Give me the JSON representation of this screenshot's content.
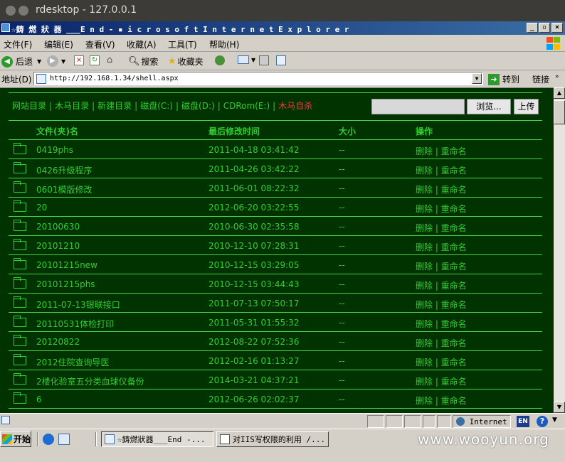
{
  "outer_window": {
    "title": "rdesktop - 127.0.0.1"
  },
  "ie_window": {
    "title": "☆鍒嗙狀鍣ㄦ___End - Microsoft Internet Explorer",
    "title_display": "☆鋳 燃 狀 器 ___E n d - ▪ i c r o s o f t   I n t e r n e t   E x p l o r e r"
  },
  "menu": [
    "文件(F)",
    "编辑(E)",
    "查看(V)",
    "收藏(A)",
    "工具(T)",
    "帮助(H)"
  ],
  "toolbar": {
    "back": "后退",
    "search": "搜索",
    "favorites": "收藏夹"
  },
  "address": {
    "label": "地址(D)",
    "url": "http://192.168.1.34/shell.aspx",
    "go": "转到",
    "links": "链接"
  },
  "nav": {
    "items": [
      "网站目录",
      "木马目录",
      "新建目录",
      "磁盘(C:)",
      "磁盘(D:)",
      "CDRom(E:)"
    ],
    "highlight": "木马自杀",
    "browse_label": "浏览...",
    "upload_label": "上传"
  },
  "table": {
    "headers": [
      "文件(夹)名",
      "最后修改时间",
      "大小",
      "操作"
    ],
    "rows": [
      {
        "name": "0419phs",
        "modified": "2011-04-18 03:41:42",
        "size": "--",
        "ops": "删除 | 重命名"
      },
      {
        "name": "0426升级程序",
        "modified": "2011-04-26 03:42:22",
        "size": "--",
        "ops": "删除 | 重命名"
      },
      {
        "name": "0601模版修改",
        "modified": "2011-06-01 08:22:32",
        "size": "--",
        "ops": "删除 | 重命名"
      },
      {
        "name": "20",
        "modified": "2012-06-20 03:22:55",
        "size": "--",
        "ops": "删除 | 重命名"
      },
      {
        "name": "20100630",
        "modified": "2010-06-30 02:35:58",
        "size": "--",
        "ops": "删除 | 重命名"
      },
      {
        "name": "20101210",
        "modified": "2010-12-10 07:28:31",
        "size": "--",
        "ops": "删除 | 重命名"
      },
      {
        "name": "20101215new",
        "modified": "2010-12-15 03:29:05",
        "size": "--",
        "ops": "删除 | 重命名"
      },
      {
        "name": "20101215phs",
        "modified": "2010-12-15 03:44:43",
        "size": "--",
        "ops": "删除 | 重命名"
      },
      {
        "name": "2011-07-13银联接口",
        "modified": "2011-07-13 07:50:17",
        "size": "--",
        "ops": "删除 | 重命名"
      },
      {
        "name": "20110531体检打印",
        "modified": "2011-05-31 01:55:32",
        "size": "--",
        "ops": "删除 | 重命名"
      },
      {
        "name": "20120822",
        "modified": "2012-08-22 07:52:36",
        "size": "--",
        "ops": "删除 | 重命名"
      },
      {
        "name": "2012住院查询导医",
        "modified": "2012-02-16 01:13:27",
        "size": "--",
        "ops": "删除 | 重命名"
      },
      {
        "name": "2楼化验室五分类血球仪备份",
        "modified": "2014-03-21 04:37:21",
        "size": "--",
        "ops": "删除 | 重命名"
      },
      {
        "name": "6",
        "modified": "2012-06-26 02:02:37",
        "size": "--",
        "ops": "删除 | 重命名"
      }
    ]
  },
  "status": {
    "zone": "Internet",
    "lang": "EN"
  },
  "taskbar": {
    "start": "开始",
    "tasks": [
      "☆鋳燃狀器___End -...",
      "对IIS写权限的利用 /..."
    ]
  },
  "watermark": "www.wooyun.org",
  "colors": {
    "bg": "#003300",
    "text": "#33cc33",
    "accent_red": "#ff3333",
    "line": "#4ad24a"
  }
}
